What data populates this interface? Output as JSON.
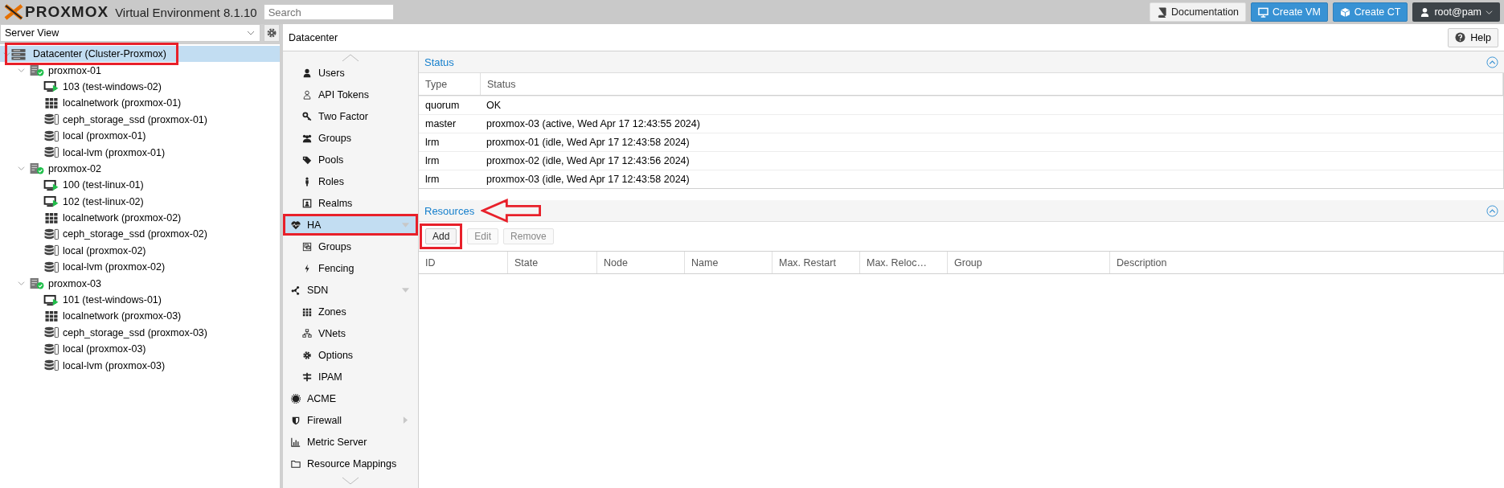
{
  "header": {
    "logo": "PROXMOX",
    "product": "Virtual Environment 8.1.10",
    "search": {
      "placeholder": "Search"
    },
    "buttons": [
      {
        "label": "Documentation",
        "kind": "plain"
      },
      {
        "label": "Create VM",
        "kind": "primary"
      },
      {
        "label": "Create CT",
        "kind": "primary"
      }
    ],
    "user": "root@pam"
  },
  "sidebar": {
    "view": "Server View",
    "tree": [
      {
        "label": "Datacenter (Cluster-Proxmox)",
        "kind": "datacenter",
        "selected": true,
        "annotated": true,
        "expanded": true,
        "children": [
          {
            "label": "proxmox-01",
            "kind": "node",
            "selected": false,
            "annotated": false,
            "expanded": true,
            "children": [
              {
                "label": "103 (test-windows-02)",
                "kind": "vm",
                "selected": false,
                "annotated": false
              },
              {
                "label": "localnetwork (proxmox-01)",
                "kind": "network",
                "selected": false,
                "annotated": false
              },
              {
                "label": "ceph_storage_ssd (proxmox-01)",
                "kind": "storage",
                "selected": false,
                "annotated": false
              },
              {
                "label": "local (proxmox-01)",
                "kind": "storage",
                "selected": false,
                "annotated": false
              },
              {
                "label": "local-lvm (proxmox-01)",
                "kind": "storage",
                "selected": false,
                "annotated": false
              }
            ]
          },
          {
            "label": "proxmox-02",
            "kind": "node",
            "selected": false,
            "annotated": false,
            "expanded": true,
            "children": [
              {
                "label": "100 (test-linux-01)",
                "kind": "vm",
                "selected": false,
                "annotated": false
              },
              {
                "label": "102 (test-linux-02)",
                "kind": "vm",
                "selected": false,
                "annotated": false
              },
              {
                "label": "localnetwork (proxmox-02)",
                "kind": "network",
                "selected": false,
                "annotated": false
              },
              {
                "label": "ceph_storage_ssd (proxmox-02)",
                "kind": "storage",
                "selected": false,
                "annotated": false
              },
              {
                "label": "local (proxmox-02)",
                "kind": "storage",
                "selected": false,
                "annotated": false
              },
              {
                "label": "local-lvm (proxmox-02)",
                "kind": "storage",
                "selected": false,
                "annotated": false
              }
            ]
          },
          {
            "label": "proxmox-03",
            "kind": "node",
            "selected": false,
            "annotated": false,
            "expanded": true,
            "children": [
              {
                "label": "101 (test-windows-01)",
                "kind": "vm",
                "selected": false,
                "annotated": false
              },
              {
                "label": "localnetwork (proxmox-03)",
                "kind": "network",
                "selected": false,
                "annotated": false
              },
              {
                "label": "ceph_storage_ssd (proxmox-03)",
                "kind": "storage",
                "selected": false,
                "annotated": false
              },
              {
                "label": "local (proxmox-03)",
                "kind": "storage",
                "selected": false,
                "annotated": false
              },
              {
                "label": "local-lvm (proxmox-03)",
                "kind": "storage",
                "selected": false,
                "annotated": false
              }
            ]
          }
        ]
      }
    ]
  },
  "content": {
    "title": "Datacenter",
    "help": "Help",
    "nav": {
      "continued_children": [
        {
          "label": "Users",
          "selected": false
        },
        {
          "label": "API Tokens",
          "selected": false
        },
        {
          "label": "Two Factor",
          "selected": false
        },
        {
          "label": "Groups",
          "selected": false
        },
        {
          "label": "Pools",
          "selected": false
        },
        {
          "label": "Roles",
          "selected": false
        },
        {
          "label": "Realms",
          "selected": false
        }
      ],
      "items": [
        {
          "label": "HA",
          "selected": true,
          "annotated": true,
          "expandable": true,
          "expanded": true,
          "children": [
            {
              "label": "Groups",
              "selected": false
            },
            {
              "label": "Fencing",
              "selected": false
            }
          ]
        },
        {
          "label": "SDN",
          "selected": false,
          "annotated": false,
          "expandable": true,
          "expanded": true,
          "children": [
            {
              "label": "Zones",
              "selected": false
            },
            {
              "label": "VNets",
              "selected": false
            },
            {
              "label": "Options",
              "selected": false
            },
            {
              "label": "IPAM",
              "selected": false
            }
          ]
        },
        {
          "label": "ACME",
          "selected": false,
          "annotated": false,
          "expandable": false
        },
        {
          "label": "Firewall",
          "selected": false,
          "annotated": false,
          "expandable": true,
          "expanded": false
        },
        {
          "label": "Metric Server",
          "selected": false,
          "annotated": false,
          "expandable": false
        },
        {
          "label": "Resource Mappings",
          "selected": false,
          "annotated": false,
          "expandable": false
        }
      ]
    },
    "status": {
      "title": "Status",
      "columns": [
        "Type",
        "Status"
      ],
      "rows": [
        [
          "quorum",
          "OK"
        ],
        [
          "master",
          "proxmox-03 (active, Wed Apr 17 12:43:55 2024)"
        ],
        [
          "lrm",
          "proxmox-01 (idle, Wed Apr 17 12:43:58 2024)"
        ],
        [
          "lrm",
          "proxmox-02 (idle, Wed Apr 17 12:43:56 2024)"
        ],
        [
          "lrm",
          "proxmox-03 (idle, Wed Apr 17 12:43:58 2024)"
        ]
      ]
    },
    "resources": {
      "title": "Resources",
      "annotated": true,
      "toolbar": [
        {
          "label": "Add",
          "disabled": false,
          "annotated": true
        },
        {
          "label": "Edit",
          "disabled": true,
          "annotated": false
        },
        {
          "label": "Remove",
          "disabled": true,
          "annotated": false
        }
      ],
      "columns": [
        "ID",
        "State",
        "Node",
        "Name",
        "Max. Restart",
        "Max. Reloc…",
        "Group",
        "Description"
      ]
    }
  }
}
